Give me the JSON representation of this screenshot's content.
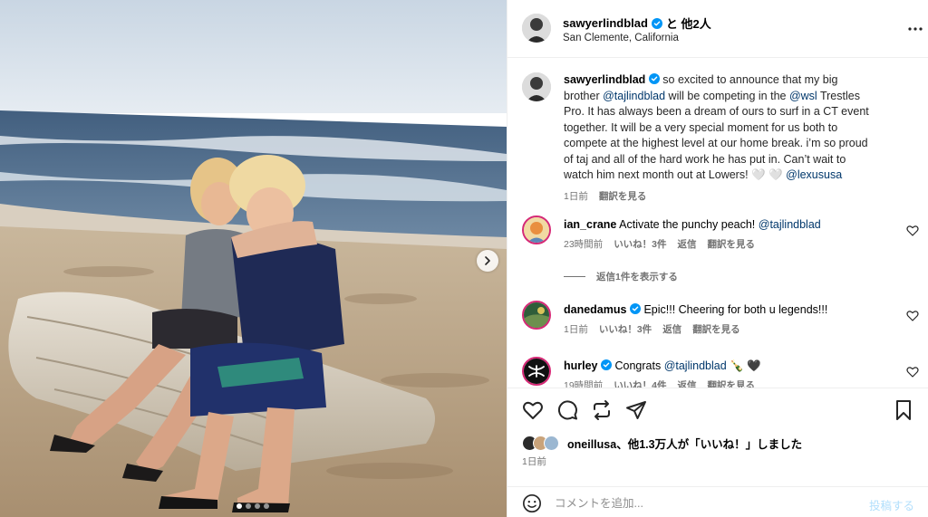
{
  "post": {
    "username": "sawyerlindblad",
    "coauthors": "と 他2人",
    "location": "San Clemente, California",
    "caption": {
      "part1": "so excited to announce that my big brother ",
      "mention1": "@tajlindblad",
      "part2": " will be competing in the ",
      "mention2": "@wsl",
      "part3": " Trestles Pro. It has always been a dream of ours to surf in a CT event together. It will be a very special moment for us both to compete at the highest level at our home break. i’m so proud of taj and all of the hard work he has put in. Can’t wait to watch him next month out at Lowers! 🤍 🤍 ",
      "mention3": "@lexususa"
    },
    "caption_time": "1日前",
    "translate": "翻訳を見る"
  },
  "comments": [
    {
      "user": "ian_crane",
      "text": "Activate the punchy peach! ",
      "mention": "@tajlindblad",
      "time": "23時間前",
      "likes": "いいね！3件",
      "reply": "返信",
      "translate": "翻訳を見る"
    },
    {
      "user": "danedamus",
      "text": "Epic!!! Cheering for both u legends!!!",
      "mention": "",
      "time": "1日前",
      "likes": "いいね！3件",
      "reply": "返信",
      "translate": "翻訳を見る"
    },
    {
      "user": "hurley",
      "text": "Congrats ",
      "mention": "@tajlindblad",
      "emoji": " 🍾 🖤",
      "time": "19時間前",
      "likes": "いいね！4件",
      "reply": "返信",
      "translate": "翻訳を見る"
    }
  ],
  "view_replies": "返信1件を表示する",
  "likes": {
    "user": "oneillusa",
    "rest": "、他1.3万人が「いいね！」しました"
  },
  "post_date": "1日前",
  "comment_box": {
    "placeholder": "コメントを追加...",
    "post_label": "投稿する"
  },
  "carousel": {
    "slides": 4,
    "active": 1
  },
  "colors": {
    "link": "#00376b",
    "verified": "#0095f6",
    "muted": "#737373",
    "post_disabled": "#b2dffc"
  }
}
